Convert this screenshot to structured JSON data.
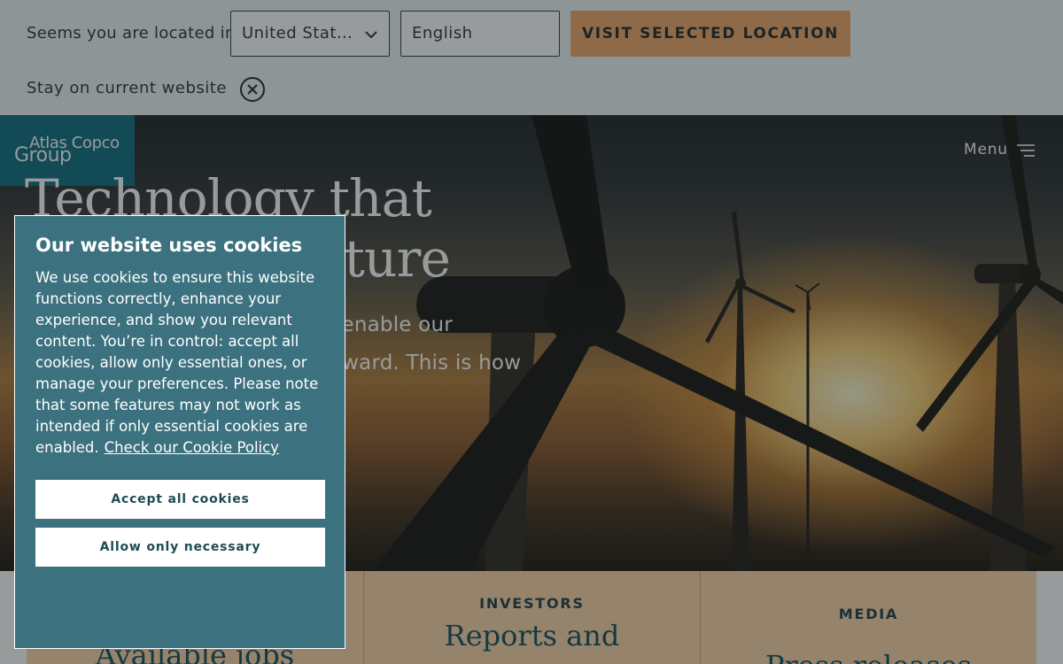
{
  "location_bar": {
    "label": "Seems you are located in:",
    "country_value": "United Stat…",
    "language_value": "English",
    "visit_button": "VISIT SELECTED LOCATION",
    "stay_label": "Stay on current website"
  },
  "header": {
    "logo_line1": "Atlas Copco",
    "logo_line2": "Group",
    "menu_label": "Menu"
  },
  "hero": {
    "title_line1": "Technology that",
    "title_line2": "drives the future",
    "desc_line1": "We develop technologies that enable our",
    "desc_line2": "customers to move society forward. This is how"
  },
  "cards": [
    {
      "kicker": "",
      "title": "Available jobs"
    },
    {
      "kicker": "INVESTORS",
      "title": "Reports and"
    },
    {
      "kicker": "MEDIA",
      "title": "Press releases"
    }
  ],
  "cookie": {
    "title": "Our website uses cookies",
    "body": "We use cookies to ensure this website functions correctly, enhance your experience, and show you relevant content. You’re in control: accept all cookies, allow only essential ones, or manage your preferences. Please note that some features may not work as intended if only essential cookies are enabled.",
    "policy_link": "Check our Cookie Policy",
    "accept_button": "Accept all cookies",
    "necessary_button": "Allow only necessary"
  },
  "colors": {
    "brand_teal": "#0b6a7e",
    "cta_orange": "#f1a465",
    "cookie_bg": "#3c727f",
    "card_bg": "#fbd3a6"
  },
  "icons": {
    "country_dropdown": "chevron-down-icon",
    "stay_close": "close-circle-icon",
    "menu": "hamburger-menu-icon"
  }
}
